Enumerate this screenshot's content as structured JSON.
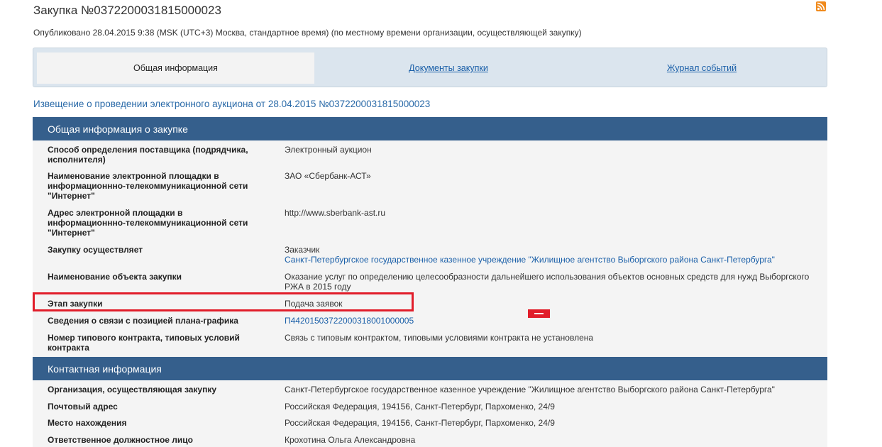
{
  "header": {
    "title": "Закупка №0372200031815000023",
    "published": "Опубликовано 28.04.2015 9:38 (MSK (UTC+3) Москва, стандартное время) (по местному времени организации, осуществляющей закупку)",
    "rss_icon": "rss-icon"
  },
  "tabs": [
    {
      "label": "Общая информация",
      "active": true
    },
    {
      "label": "Документы закупки",
      "active": false
    },
    {
      "label": "Журнал событий",
      "active": false
    }
  ],
  "notice_title": "Извещение о проведении электронного аукциона от 28.04.2015 №0372200031815000023",
  "general": {
    "header": "Общая информация о закупке",
    "rows": [
      {
        "label": "Способ определения поставщика (подрядчика, исполнителя)",
        "value": "Электронный аукцион"
      },
      {
        "label": "Наименование электронной площадки в информационнно-телекоммуникационной сети \"Интернет\"",
        "value": "ЗАО «Сбербанк-АСТ»"
      },
      {
        "label": "Адрес электронной площадки в информационнно-телекоммуникационной сети \"Интернет\"",
        "value": "http://www.sberbank-ast.ru"
      },
      {
        "label": "Закупку осуществляет",
        "value": "Заказчик",
        "value_link": "Санкт-Петербургское государственное казенное учреждение \"Жилищное агентство Выборгского района Санкт-Петербурга\""
      },
      {
        "label": "Наименование объекта закупки",
        "value": "Оказание услуг по определению целесообразности дальнейшего использования объектов основных средств для нужд Выборгского РЖА в 2015 году"
      },
      {
        "label": "Этап закупки",
        "value": "Подача заявок"
      },
      {
        "label": "Сведения о связи с позицией плана-графика",
        "value_link": "П44201503722000318001000005"
      },
      {
        "label": "Номер типового контракта, типовых условий контракта",
        "value": "Связь с типовым контрактом, типовыми условиями контракта не установлена"
      }
    ]
  },
  "contact": {
    "header": "Контактная информация",
    "rows": [
      {
        "label": "Организация, осуществляющая закупку",
        "value": "Санкт-Петербургское государственное казенное учреждение \"Жилищное агентство Выборгского района Санкт-Петербурга\""
      },
      {
        "label": "Почтовый адрес",
        "value": "Российская Федерация, 194156, Санкт-Петербург, Пархоменко, 24/9"
      },
      {
        "label": "Место нахождения",
        "value": "Российская Федерация, 194156, Санкт-Петербург, Пархоменко, 24/9"
      },
      {
        "label": "Ответственное должностное лицо",
        "value": "Крохотина Ольга Александровна"
      }
    ]
  },
  "colors": {
    "section_header": "#355f8c",
    "link": "#1a5fa8",
    "highlight": "#e11d2a"
  }
}
